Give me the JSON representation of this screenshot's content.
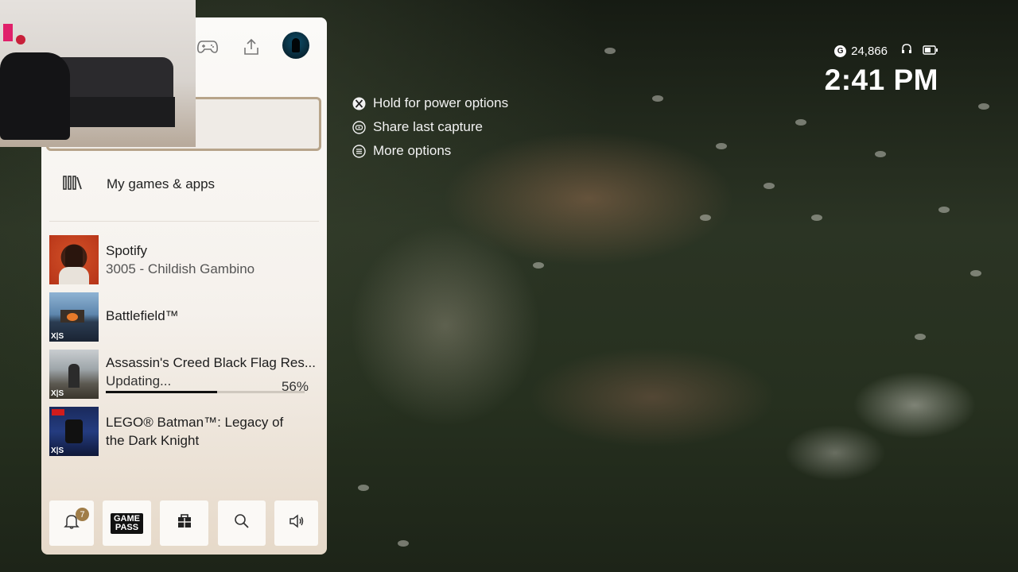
{
  "guide": {
    "menu_label": "My games & apps",
    "items": [
      {
        "title": "Spotify",
        "subtitle": "3005 - Childish Gambino"
      },
      {
        "title": "Battlefield™",
        "badge": "X|S"
      },
      {
        "title": "Assassin's Creed Black Flag Res...",
        "status": "Updating...",
        "progress_pct": 56,
        "progress_label": "56%",
        "badge": "X|S"
      },
      {
        "title_line1": "LEGO® Batman™: Legacy of",
        "title_line2": "the Dark Knight",
        "badge": "X|S"
      }
    ],
    "notification_count": "7",
    "gamepass_line1": "GAME",
    "gamepass_line2": "PASS"
  },
  "hints": [
    {
      "icon": "xbox-button-icon",
      "label": "Hold for power options"
    },
    {
      "icon": "share-button-icon",
      "label": "Share last capture"
    },
    {
      "icon": "menu-button-icon",
      "label": "More options"
    }
  ],
  "status": {
    "gamerscore": "24,866",
    "gamerscore_icon": "G",
    "time": "2:41 PM"
  }
}
